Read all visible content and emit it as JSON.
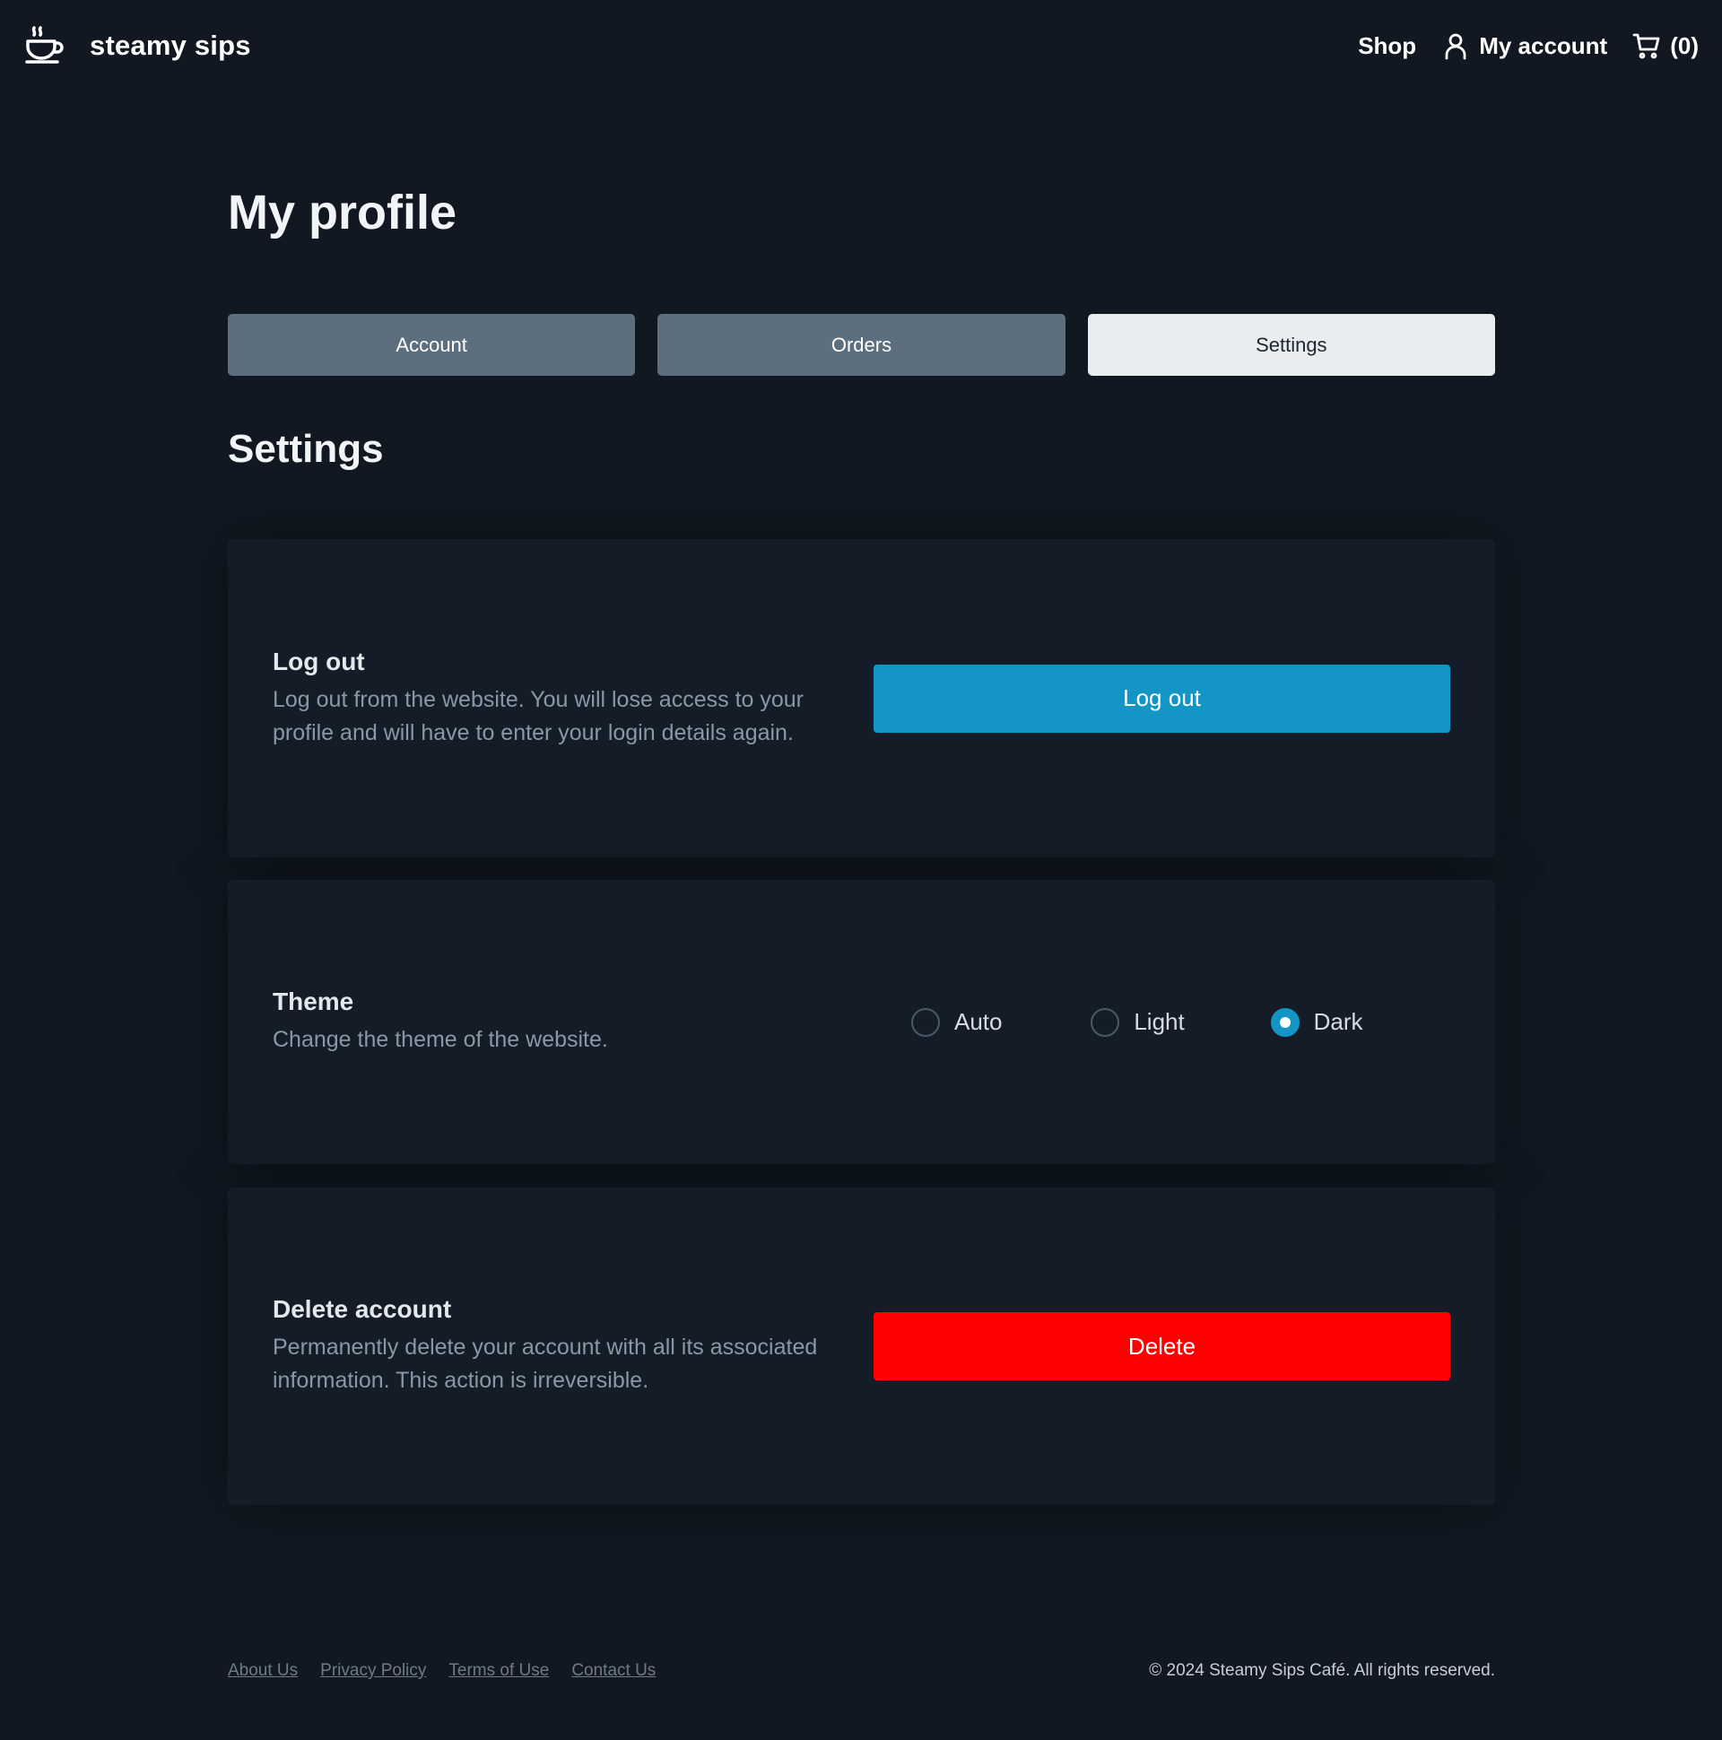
{
  "header": {
    "brand_name": "steamy sips",
    "nav": {
      "shop_label": "Shop",
      "account_label": "My account",
      "cart_label": "(0)"
    }
  },
  "main": {
    "page_title": "My profile",
    "tabs": [
      {
        "label": "Account",
        "active": false
      },
      {
        "label": "Orders",
        "active": false
      },
      {
        "label": "Settings",
        "active": true
      }
    ],
    "section_title": "Settings",
    "logout_card": {
      "title": "Log out",
      "description": "Log out from the website. You will lose access to your profile and will have to enter your login details again.",
      "button_label": "Log out"
    },
    "theme_card": {
      "title": "Theme",
      "description": "Change the theme of the website.",
      "options": [
        {
          "label": "Auto",
          "selected": false
        },
        {
          "label": "Light",
          "selected": false
        },
        {
          "label": "Dark",
          "selected": true
        }
      ]
    },
    "delete_card": {
      "title": "Delete account",
      "description": "Permanently delete your account with all its associated information. This action is irreversible.",
      "button_label": "Delete"
    }
  },
  "footer": {
    "links": [
      "About Us",
      "Privacy Policy",
      "Terms of Use",
      "Contact Us"
    ],
    "copyright": "© 2024 Steamy Sips Café. All rights reserved."
  },
  "colors": {
    "background": "#111821",
    "card": "#141d27",
    "accent": "#1396c5",
    "danger": "#ff0000",
    "tab_inactive": "#5d6e7e",
    "tab_active": "#e9edf0"
  },
  "icons": {
    "brand": "coffee-cup-icon",
    "account": "user-icon",
    "cart": "cart-icon"
  }
}
